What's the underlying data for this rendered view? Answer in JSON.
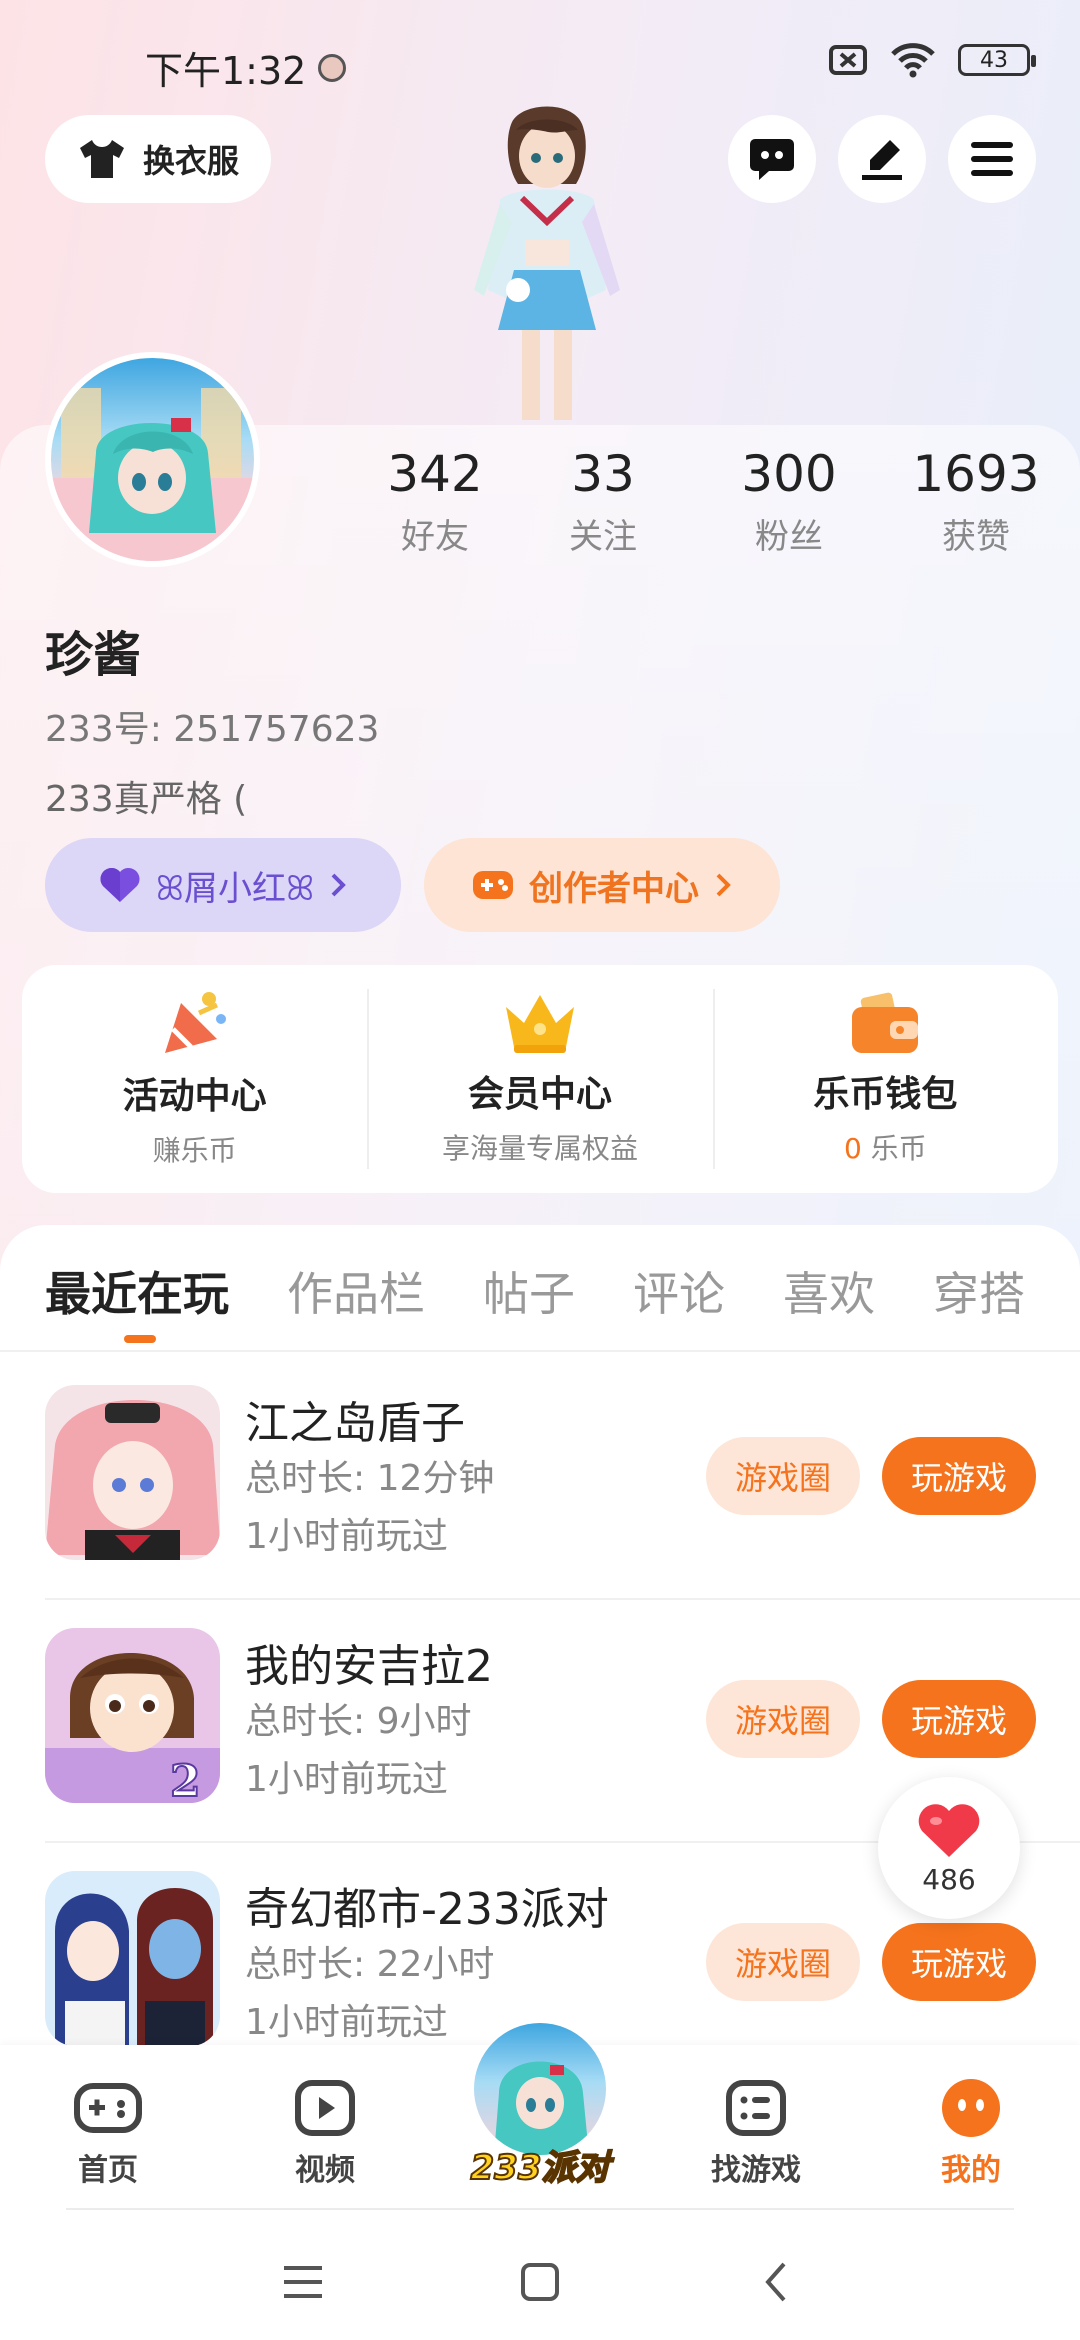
{
  "status": {
    "time": "下午1:32",
    "battery": "43"
  },
  "top_bar": {
    "outfit_label": "换衣服"
  },
  "profile": {
    "username": "珍酱",
    "uid": "233号: 251757623",
    "bio": "233真严格 (",
    "stats": [
      {
        "value": "342",
        "label": "好友"
      },
      {
        "value": "33",
        "label": "关注"
      },
      {
        "value": "300",
        "label": "粉丝"
      },
      {
        "value": "1693",
        "label": "获赞"
      }
    ],
    "badge_label": "ꕤ屑小红ꕤ",
    "creator_label": "创作者中心"
  },
  "quick": [
    {
      "title": "活动中心",
      "sub": "赚乐币"
    },
    {
      "title": "会员中心",
      "sub": "享海量专属权益"
    },
    {
      "title": "乐币钱包",
      "sub_value": "0",
      "sub": "乐币"
    }
  ],
  "tabs": [
    "最近在玩",
    "作品栏",
    "帖子",
    "评论",
    "喜欢",
    "穿搭"
  ],
  "games": [
    {
      "name": "江之岛盾子",
      "duration": "总时长: 12分钟",
      "last": "1小时前玩过",
      "circle": "游戏圈",
      "play": "玩游戏"
    },
    {
      "name": "我的安吉拉2",
      "duration": "总时长: 9小时",
      "last": "1小时前玩过",
      "circle": "游戏圈",
      "play": "玩游戏"
    },
    {
      "name": "奇幻都市-233派对",
      "duration": "总时长: 22小时",
      "last": "1小时前玩过",
      "circle": "游戏圈",
      "play": "玩游戏"
    }
  ],
  "like_count": "486",
  "nav": {
    "home": "首页",
    "video": "视频",
    "party": "233派对",
    "find": "找游戏",
    "mine": "我的"
  },
  "colors": {
    "accent": "#f5731c",
    "purple": "#6a4fd0"
  }
}
